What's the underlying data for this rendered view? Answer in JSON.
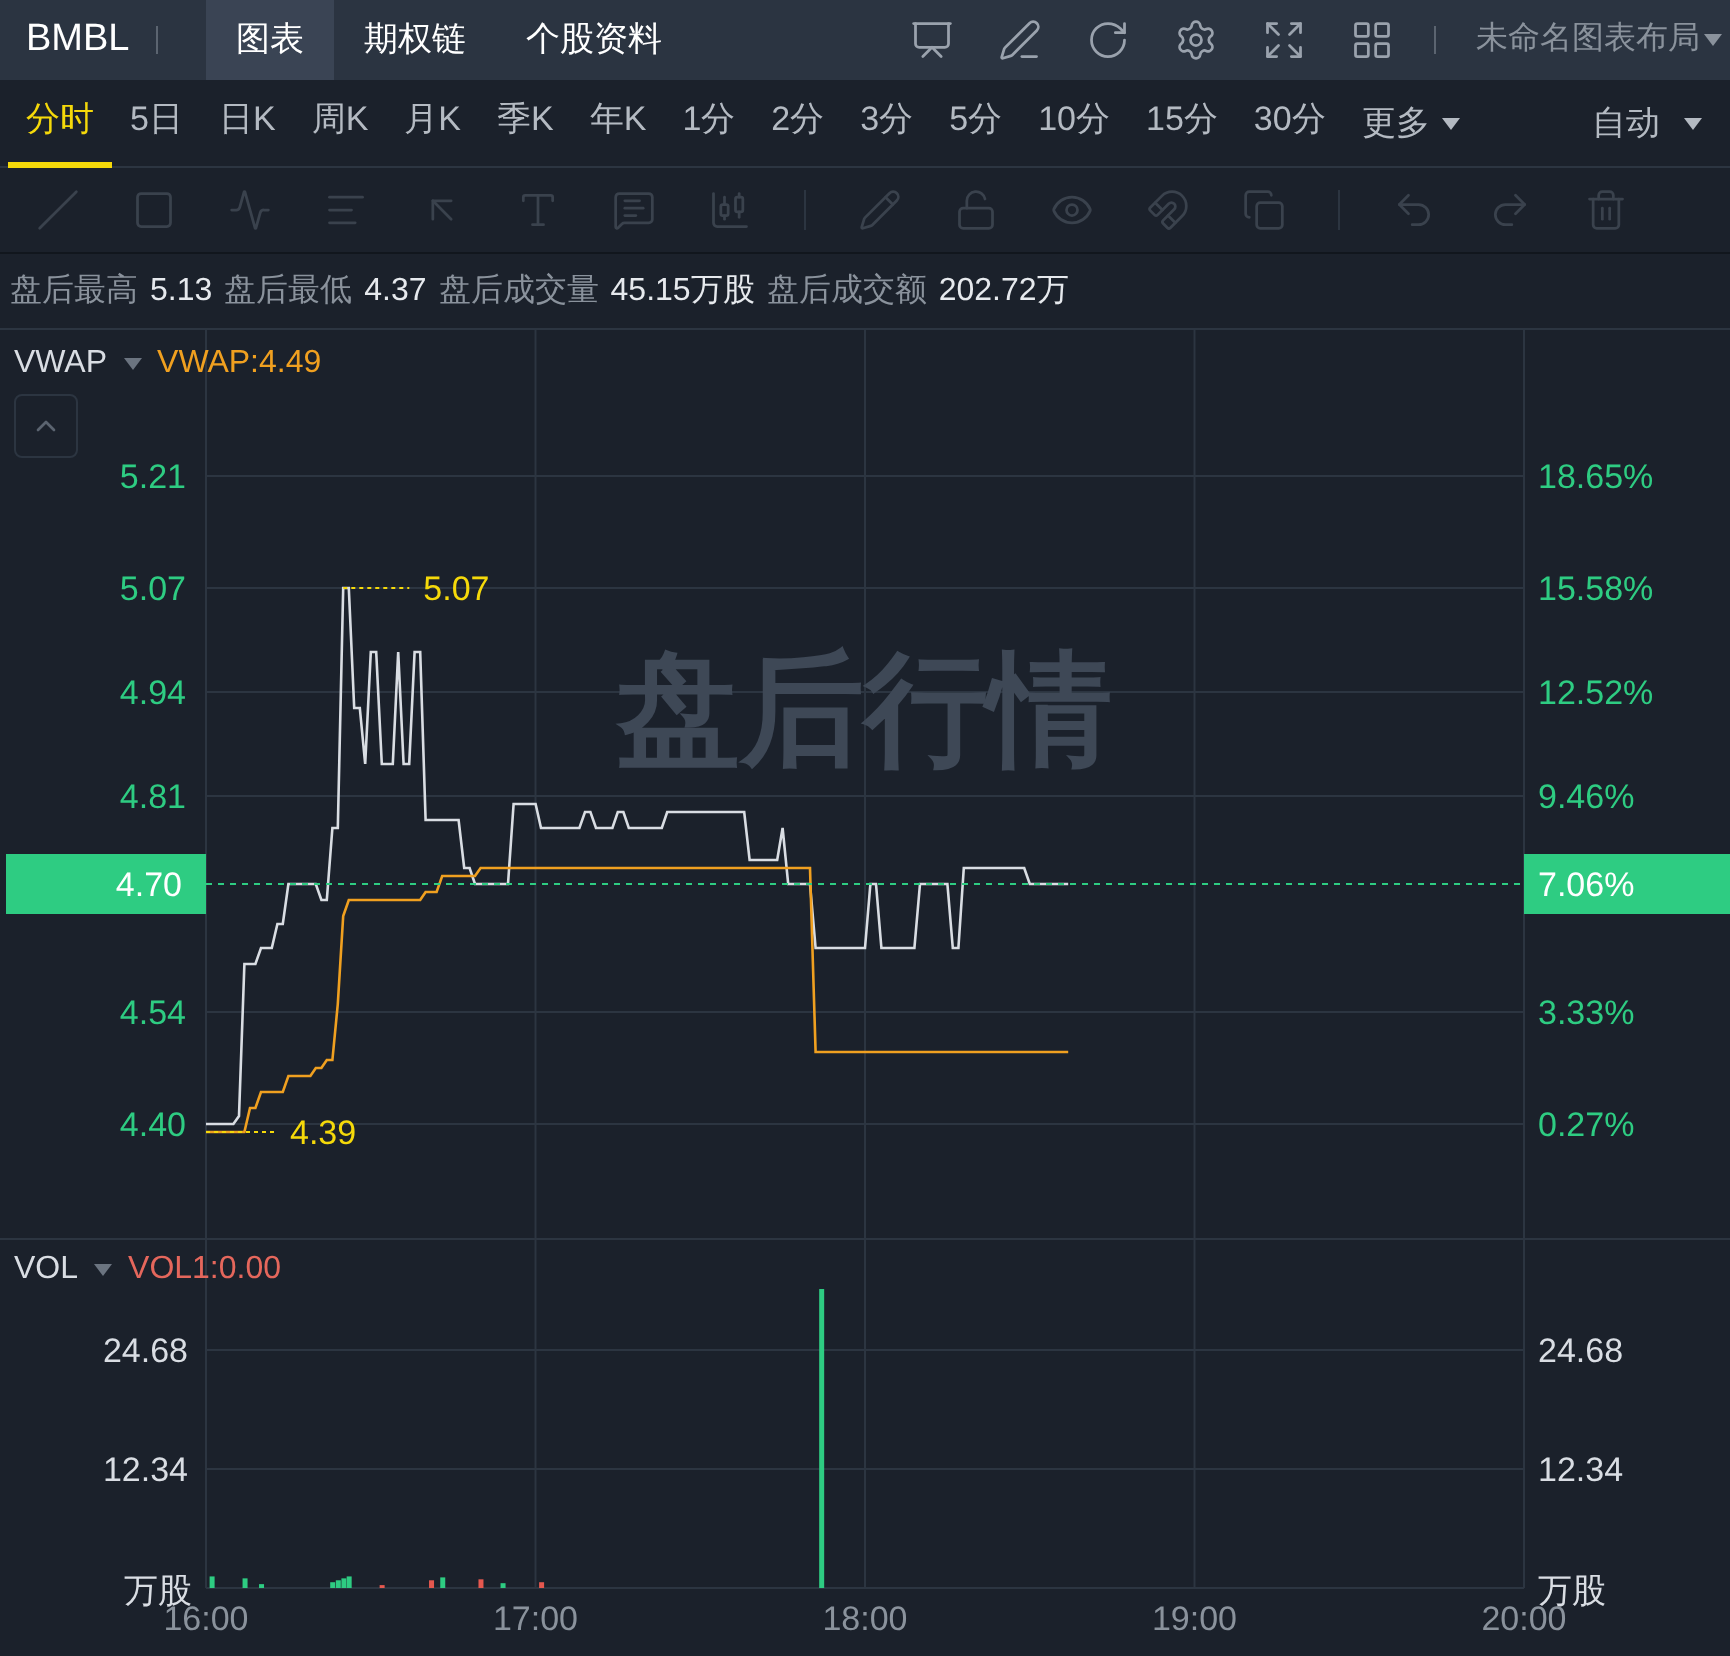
{
  "header": {
    "symbol": "BMBL",
    "tabs": [
      {
        "label": "图表",
        "selected": true
      },
      {
        "label": "期权链",
        "selected": false
      },
      {
        "label": "个股资料",
        "selected": false
      }
    ],
    "actions": [
      {
        "kind": "presentation"
      },
      {
        "kind": "edit"
      },
      {
        "kind": "refresh"
      },
      {
        "kind": "settings"
      },
      {
        "kind": "fullscreen"
      },
      {
        "kind": "grid"
      }
    ],
    "layout_menu": "未命名图表布局"
  },
  "periods": [
    {
      "label": "分时",
      "selected": true
    },
    {
      "label": "5日",
      "selected": false
    },
    {
      "label": "日K",
      "selected": false
    },
    {
      "label": "周K",
      "selected": false
    },
    {
      "label": "月K",
      "selected": false
    },
    {
      "label": "季K",
      "selected": false
    },
    {
      "label": "年K",
      "selected": false
    },
    {
      "label": "1分",
      "selected": false
    },
    {
      "label": "2分",
      "selected": false
    },
    {
      "label": "3分",
      "selected": false
    },
    {
      "label": "5分",
      "selected": false
    },
    {
      "label": "10分",
      "selected": false
    },
    {
      "label": "15分",
      "selected": false
    },
    {
      "label": "30分",
      "selected": false
    }
  ],
  "more_menu": "更多",
  "scale_menu": "自动",
  "tools": [
    {
      "kind": "line",
      "disabled": true
    },
    {
      "kind": "rect",
      "disabled": true
    },
    {
      "kind": "wave",
      "disabled": true
    },
    {
      "kind": "text-lines",
      "disabled": true
    },
    {
      "kind": "arrow",
      "disabled": true
    },
    {
      "kind": "text-cursor",
      "disabled": true
    },
    {
      "kind": "label",
      "disabled": true
    },
    {
      "kind": "candles",
      "disabled": true
    },
    {
      "kind": "sep"
    },
    {
      "kind": "pencil",
      "disabled": true
    },
    {
      "kind": "lock",
      "disabled": true
    },
    {
      "kind": "eye",
      "disabled": true
    },
    {
      "kind": "magnet",
      "disabled": true
    },
    {
      "kind": "copy",
      "disabled": true
    },
    {
      "kind": "sep"
    },
    {
      "kind": "undo",
      "disabled": true
    },
    {
      "kind": "redo",
      "disabled": true
    },
    {
      "kind": "trash",
      "disabled": true
    }
  ],
  "stats": [
    {
      "label": "盘后最高",
      "value": "5.13"
    },
    {
      "label": "盘后最低",
      "value": "4.37"
    },
    {
      "label": "盘后成交量",
      "value": "45.15万股"
    },
    {
      "label": "盘后成交额",
      "value": "202.72万"
    }
  ],
  "price_pane": {
    "indicator": "VWAP",
    "indicator_value": "VWAP:4.49",
    "watermark": "盘后行情",
    "high_marker": "5.07",
    "low_marker": "4.39",
    "last_price": "4.70",
    "last_change": "7.06%",
    "right_axis_labels": [
      "18.65%",
      "15.58%",
      "12.52%",
      "9.46%",
      "3.33%",
      "0.27%"
    ],
    "chart_data": {
      "type": "line",
      "categories": [
        null,
        null,
        null,
        null,
        null,
        null,
        null,
        null,
        null,
        null,
        null,
        null,
        null,
        null,
        null,
        null,
        null,
        null,
        null,
        null,
        null,
        null,
        null,
        null,
        null,
        null,
        null,
        null,
        null,
        null,
        null,
        null,
        null,
        null,
        null,
        null,
        null,
        null,
        null,
        null,
        null,
        null,
        null,
        null,
        null,
        null,
        null,
        null,
        null,
        null,
        null,
        null,
        null,
        null,
        null,
        null,
        null,
        null,
        null,
        null,
        null,
        null,
        null,
        null,
        null,
        null,
        null,
        null,
        null,
        null,
        null,
        null,
        null,
        null,
        null,
        null,
        null,
        null,
        null,
        null,
        null,
        null,
        null,
        null,
        null,
        null,
        null,
        null,
        null,
        null,
        null,
        null,
        null,
        null,
        null,
        null,
        null,
        null,
        null,
        null,
        null,
        null,
        null,
        null,
        null,
        null,
        null,
        null,
        null,
        null,
        null,
        null,
        null,
        null,
        null,
        null,
        null,
        null,
        null,
        null,
        null,
        null,
        null,
        null,
        null,
        null,
        null,
        null,
        null,
        null,
        null,
        null,
        null,
        null,
        null,
        null,
        null,
        null,
        null,
        null,
        null,
        null,
        null,
        null,
        null,
        null,
        null,
        null,
        null,
        null,
        null,
        null,
        null,
        null,
        null,
        null,
        null,
        null
      ],
      "yticks": [
        {
          "value": 5.21,
          "label": "5.21"
        },
        {
          "value": 5.07,
          "label": "5.07"
        },
        {
          "value": 4.94,
          "label": "4.94"
        },
        {
          "value": 4.81,
          "label": "4.81"
        },
        {
          "value": 4.54,
          "label": "4.54"
        },
        {
          "value": 4.4,
          "label": "4.40"
        }
      ],
      "ylim": [
        4.2575,
        5.395
      ],
      "grid": true,
      "series": [
        {
          "color": "#d9dde3",
          "values": [
            4.4,
            4.4,
            4.4,
            4.4,
            4.4,
            4.4,
            4.41,
            4.6,
            4.6,
            4.6,
            4.62,
            4.62,
            4.62,
            4.65,
            4.65,
            4.7,
            4.7,
            4.7,
            4.7,
            4.7,
            4.7,
            4.68,
            4.68,
            4.77,
            4.77,
            5.07,
            5.07,
            4.92,
            4.92,
            4.85,
            4.99,
            4.99,
            4.85,
            4.85,
            4.85,
            4.99,
            4.85,
            4.85,
            4.99,
            4.99,
            4.78,
            4.78,
            4.78,
            4.78,
            4.78,
            4.78,
            4.78,
            4.72,
            4.72,
            4.7,
            4.7,
            4.7,
            4.7,
            4.7,
            4.7,
            4.7,
            4.8,
            4.8,
            4.8,
            4.8,
            4.8,
            4.77,
            4.77,
            4.77,
            4.77,
            4.77,
            4.77,
            4.77,
            4.77,
            4.79,
            4.79,
            4.77,
            4.77,
            4.77,
            4.77,
            4.79,
            4.79,
            4.77,
            4.77,
            4.77,
            4.77,
            4.77,
            4.77,
            4.77,
            4.79,
            4.79,
            4.79,
            4.79,
            4.79,
            4.79,
            4.79,
            4.79,
            4.79,
            4.79,
            4.79,
            4.79,
            4.79,
            4.79,
            4.79,
            4.73,
            4.73,
            4.73,
            4.73,
            4.73,
            4.73,
            4.77,
            4.7,
            4.7,
            4.7,
            4.7,
            4.7,
            4.62,
            4.62,
            4.62,
            4.62,
            4.62,
            4.62,
            4.62,
            4.62,
            4.62,
            4.62,
            4.7,
            4.7,
            4.62,
            4.62,
            4.62,
            4.62,
            4.62,
            4.62,
            4.62,
            4.7,
            4.7,
            4.7,
            4.7,
            4.7,
            4.7,
            4.62,
            4.62,
            4.72,
            4.72,
            4.72,
            4.72,
            4.72,
            4.72,
            4.72,
            4.72,
            4.72,
            4.72,
            4.72,
            4.72,
            4.7,
            4.7,
            4.7,
            4.7,
            4.7,
            4.7,
            4.7,
            4.7
          ]
        },
        {
          "color": "#f0a020",
          "values": [
            4.39,
            4.39,
            4.39,
            4.39,
            4.39,
            4.39,
            4.39,
            4.39,
            4.42,
            4.42,
            4.44,
            4.44,
            4.44,
            4.44,
            4.44,
            4.46,
            4.46,
            4.46,
            4.46,
            4.46,
            4.47,
            4.47,
            4.48,
            4.48,
            4.55,
            4.66,
            4.68,
            4.68,
            4.68,
            4.68,
            4.68,
            4.68,
            4.68,
            4.68,
            4.68,
            4.68,
            4.68,
            4.68,
            4.68,
            4.68,
            4.69,
            4.69,
            4.69,
            4.71,
            4.71,
            4.71,
            4.71,
            4.71,
            4.71,
            4.71,
            4.72,
            4.72,
            4.72,
            4.72,
            4.72,
            4.72,
            4.72,
            4.72,
            4.72,
            4.72,
            4.72,
            4.72,
            4.72,
            4.72,
            4.72,
            4.72,
            4.72,
            4.72,
            4.72,
            4.72,
            4.72,
            4.72,
            4.72,
            4.72,
            4.72,
            4.72,
            4.72,
            4.72,
            4.72,
            4.72,
            4.72,
            4.72,
            4.72,
            4.72,
            4.72,
            4.72,
            4.72,
            4.72,
            4.72,
            4.72,
            4.72,
            4.72,
            4.72,
            4.72,
            4.72,
            4.72,
            4.72,
            4.72,
            4.72,
            4.72,
            4.72,
            4.72,
            4.72,
            4.72,
            4.72,
            4.72,
            4.72,
            4.72,
            4.72,
            4.72,
            4.72,
            4.49,
            4.49,
            4.49,
            4.49,
            4.49,
            4.49,
            4.49,
            4.49,
            4.49,
            4.49,
            4.49,
            4.49,
            4.49,
            4.49,
            4.49,
            4.49,
            4.49,
            4.49,
            4.49,
            4.49,
            4.49,
            4.49,
            4.49,
            4.49,
            4.49,
            4.49,
            4.49,
            4.49,
            4.49,
            4.49,
            4.49,
            4.49,
            4.49,
            4.49,
            4.49,
            4.49,
            4.49,
            4.49,
            4.49,
            4.49,
            4.49,
            4.49,
            4.49,
            4.49,
            4.49,
            4.49,
            4.49
          ]
        }
      ]
    }
  },
  "volume_pane": {
    "indicator": "VOL",
    "indicator_value": "VOL1:0.00",
    "unit_left": "万股",
    "unit_right": "万股",
    "right_axis_labels": [
      "24.68",
      "12.34"
    ],
    "chart_data": {
      "type": "bar",
      "x": [
        16.017,
        16.117,
        16.167,
        16.383,
        16.4,
        16.417,
        16.433,
        16.533,
        16.683,
        16.717,
        16.833,
        16.9,
        17.017,
        17.867
      ],
      "xticks": [
        {
          "value": 16,
          "label": "16:00"
        },
        {
          "value": 17,
          "label": "17:00"
        },
        {
          "value": 18,
          "label": "18:00"
        },
        {
          "value": 19,
          "label": "19:00"
        },
        {
          "value": 20,
          "label": "20:00"
        }
      ],
      "yticks": [
        {
          "value": 24.68,
          "label": "24.68"
        },
        {
          "value": 12.34,
          "label": "12.34"
        }
      ],
      "xlim": [
        16,
        20
      ],
      "ylim": [
        0,
        36
      ],
      "grid": true,
      "series": [
        {
          "color": "#2ecc82",
          "values": [
            1.2,
            1.0,
            0.4,
            0.6,
            0.8,
            1.0,
            1.2,
            null,
            null,
            1.1,
            null,
            0.5,
            null,
            31.0
          ]
        },
        {
          "color": "#e5584f",
          "values": [
            null,
            null,
            null,
            null,
            null,
            null,
            null,
            0.3,
            0.8,
            null,
            0.9,
            null,
            0.6,
            null
          ]
        }
      ]
    }
  }
}
